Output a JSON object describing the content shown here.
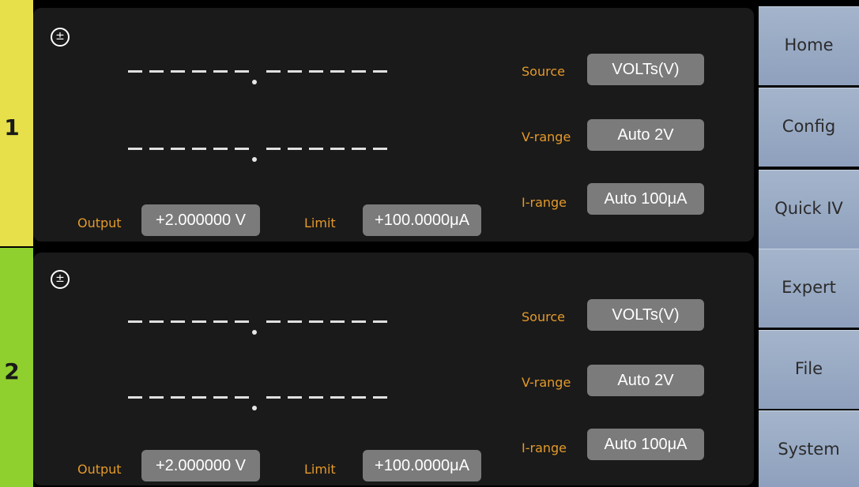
{
  "colors": {
    "ch1_accent": "#e8e04a",
    "ch2_accent": "#8fd02e",
    "label_orange": "#e49a2a",
    "value_box": "#7b7b7b",
    "menu_button": "#97a9c4"
  },
  "channels": [
    {
      "number": "1",
      "icon": "plus-minus-icon",
      "source_label": "Source",
      "source_value": "VOLTs(V)",
      "vrange_label": "V-range",
      "vrange_value": "Auto 2V",
      "irange_label": "I-range",
      "irange_value": "Auto 100μA",
      "output_label": "Output",
      "output_value": "+2.000000 V",
      "limit_label": "Limit",
      "limit_value": "+100.0000μA"
    },
    {
      "number": "2",
      "icon": "plus-minus-icon",
      "source_label": "Source",
      "source_value": "VOLTs(V)",
      "vrange_label": "V-range",
      "vrange_value": "Auto 2V",
      "irange_label": "I-range",
      "irange_value": "Auto 100μA",
      "output_label": "Output",
      "output_value": "+2.000000 V",
      "limit_label": "Limit",
      "limit_value": "+100.0000μA"
    }
  ],
  "menu": [
    {
      "label": "Home"
    },
    {
      "label": "Config"
    },
    {
      "label": "Quick IV"
    },
    {
      "label": "Expert"
    },
    {
      "label": "File"
    },
    {
      "label": "System"
    }
  ]
}
